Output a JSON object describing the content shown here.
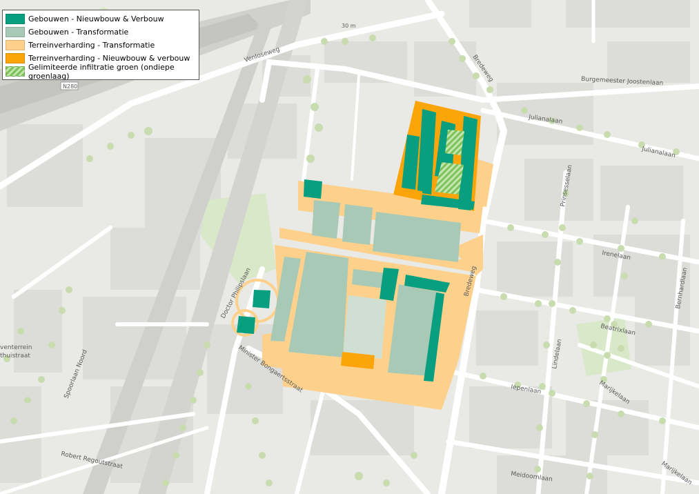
{
  "legend": {
    "items": [
      {
        "label": "Gebouwen - Nieuwbouw & Verbouw",
        "color": "#079f7f",
        "pattern": "solid"
      },
      {
        "label": "Gebouwen - Transformatie",
        "color": "#a8c9b5",
        "pattern": "solid"
      },
      {
        "label": "Terreinverharding - Transformatie",
        "color": "#fdd18b",
        "pattern": "solid"
      },
      {
        "label": "Terreinverharding - Nieuwbouw & verbouw",
        "color": "#fca50a",
        "pattern": "solid"
      },
      {
        "label": "Gelimiteerde infiltratie groen (ondiepe groenlaag)",
        "color": "#7cc35a",
        "pattern": "hatch"
      }
    ]
  },
  "streets": {
    "venloseweg": "Venloseweg",
    "n280": "N280",
    "distance": "30 m",
    "bredeweg_north": "Bredeweg",
    "bredeweg_south": "Bredeweg",
    "burgemeester": "Burgemeester Joostenlaan",
    "julianalaan_1": "Julianalaan",
    "julianalaan_2": "Julianalaan",
    "prinsesselaan": "Prinsesselaan",
    "irenelaan": "Irenelaan",
    "bernhardlaan": "Bernhardlaan",
    "beatrixlaan": "Beatrixlaan",
    "lindelaan": "Lindelaan",
    "marijkelaan_1": "Marijkelaan",
    "marijkelaan_2": "Marijkelaan",
    "iepenlaan": "Iepenlaan",
    "meidoornlaan": "Meidoornlaan",
    "doctor_philips": "Doctor Philipslaan",
    "minister_bongaerts": "Minister Bongaertsstraat",
    "spoorlaan": "Spoorlaan Noord",
    "robert": "Robert Regoutstraat",
    "bedrijventerrein_1": "venterrein",
    "bedrijventerrein_2": "thuistraat"
  },
  "colors": {
    "background": "#e9e9e6",
    "road": "#ffffff",
    "building": "#d5d5d2",
    "tree": "#c8dcaf",
    "grass": "#d9e8c8"
  }
}
